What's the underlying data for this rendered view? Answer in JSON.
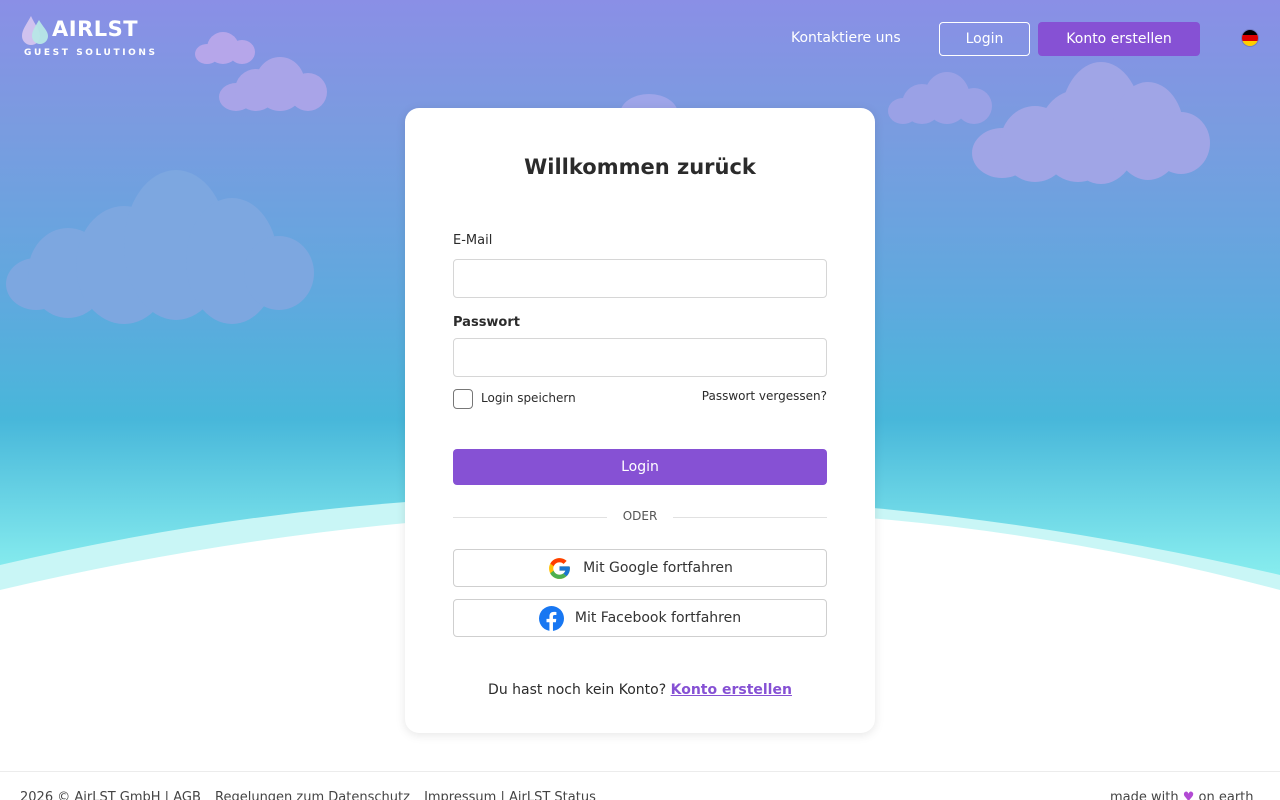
{
  "header": {
    "logo_text": "AIRLST",
    "logo_sub": "GUEST SOLUTIONS",
    "nav_contact": "Kontaktiere uns",
    "nav_login": "Login",
    "nav_signup": "Konto erstellen",
    "language_flag": "german-flag-icon"
  },
  "card": {
    "title": "Willkommen zurück",
    "email_label": "E-Mail",
    "email_value": "",
    "password_label": "Passwort",
    "password_value": "",
    "remember_label": "Login speichern",
    "forgot_label": "Passwort vergessen?",
    "login_button": "Login",
    "divider": "ODER",
    "google_button": "Mit Google fortfahren",
    "facebook_button": "Mit Facebook fortfahren",
    "signup_prompt": "Du hast noch kein Konto?",
    "signup_link": "Konto erstellen"
  },
  "footer": {
    "copyright": "2026 © AirLST GmbH",
    "sep1": "|",
    "agb": "AGB",
    "privacy": "Regelungen zum Datenschutz",
    "imprint": "Impressum",
    "sep2": "|",
    "status": "AirLST Status",
    "made_with": "made with",
    "heart": "♥",
    "on_earth": "on earth"
  },
  "colors": {
    "accent": "#8651d4",
    "heart": "#b24ad4"
  }
}
